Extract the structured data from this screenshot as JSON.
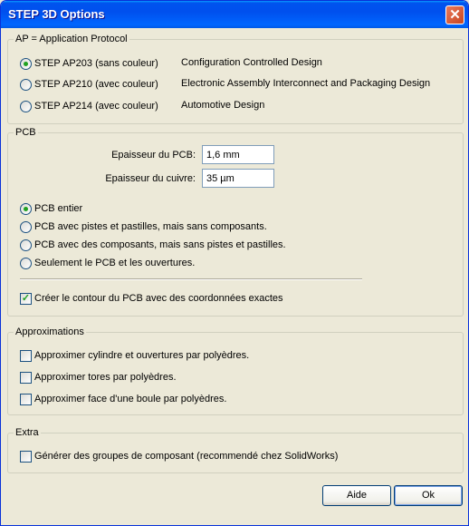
{
  "window": {
    "title": "STEP 3D Options",
    "close_label": "✕"
  },
  "ap": {
    "legend": "AP = Application Protocol",
    "options": [
      {
        "label": "STEP AP203 (sans couleur)",
        "desc": "Configuration Controlled Design",
        "checked": true
      },
      {
        "label": "STEP AP210 (avec couleur)",
        "desc": "Electronic Assembly Interconnect and Packaging Design",
        "checked": false
      },
      {
        "label": "STEP AP214 (avec couleur)",
        "desc": "Automotive Design",
        "checked": false
      }
    ]
  },
  "pcb": {
    "legend": "PCB",
    "thickness_label": "Epaisseur du PCB:",
    "thickness_value": "1,6 mm",
    "copper_label": "Epaisseur du cuivre:",
    "copper_value": "35 µm",
    "options": [
      {
        "label": "PCB entier",
        "checked": true
      },
      {
        "label": "PCB avec pistes et pastilles, mais sans composants.",
        "checked": false
      },
      {
        "label": "PCB avec des composants, mais sans pistes et pastilles.",
        "checked": false
      },
      {
        "label": "Seulement le PCB et les ouvertures.",
        "checked": false
      }
    ],
    "contour_label": "Créer le contour du PCB avec des coordonnées exactes",
    "contour_checked": true
  },
  "approx": {
    "legend": "Approximations",
    "options": [
      {
        "label": "Approximer cylindre et ouvertures par polyèdres.",
        "checked": false
      },
      {
        "label": "Approximer tores par polyèdres.",
        "checked": false
      },
      {
        "label": "Approximer face d'une boule par polyèdres.",
        "checked": false
      }
    ]
  },
  "extra": {
    "legend": "Extra",
    "groups_label": "Générer des groupes de composant (recommendé chez SolidWorks)",
    "groups_checked": false
  },
  "buttons": {
    "help_label": "Aide",
    "ok_label": "Ok"
  }
}
